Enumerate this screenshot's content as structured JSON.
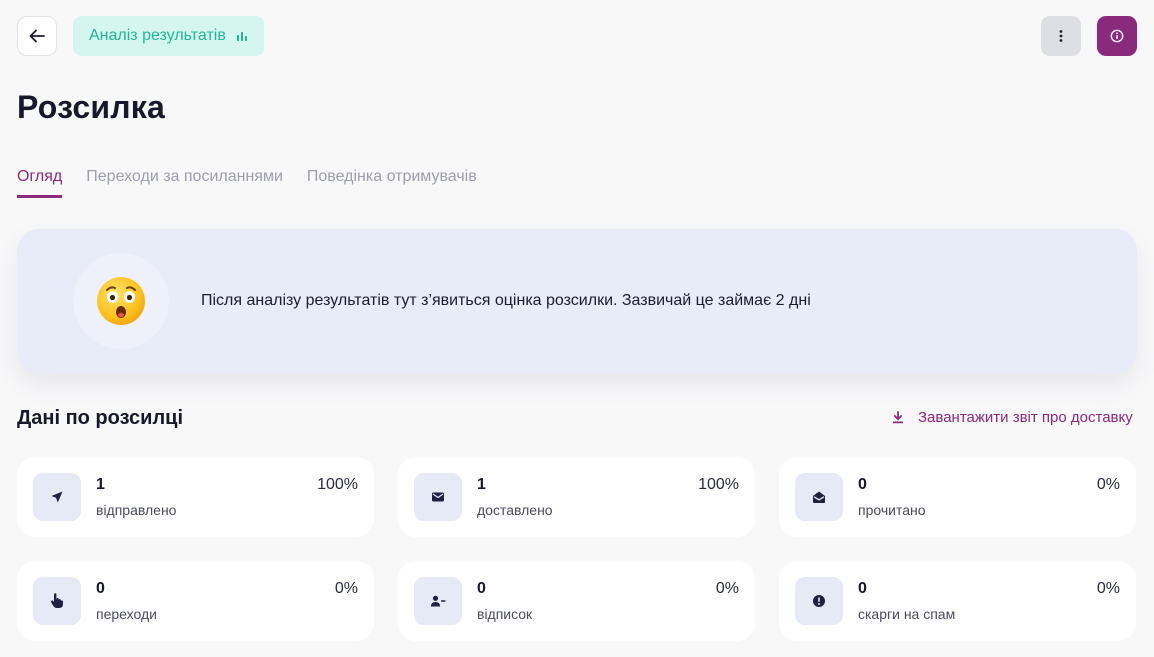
{
  "header": {
    "analysis_label": "Аналіз результатів"
  },
  "title": "Розсилка",
  "tabs": [
    {
      "label": "Огляд",
      "active": true
    },
    {
      "label": "Переходи за посиланнями",
      "active": false
    },
    {
      "label": "Поведінка отримувачів",
      "active": false
    }
  ],
  "banner": {
    "emoji": "astonished-face",
    "text": "Після аналізу результатів тут з’явиться оцінка розсилки. Зазвичай це займає 2 дні"
  },
  "section": {
    "title": "Дані по розсилці",
    "download_label": "Завантажити звіт про доставку"
  },
  "stats": [
    {
      "icon": "send-icon",
      "value": "1",
      "label": "відправлено",
      "percent": "100%"
    },
    {
      "icon": "envelope-icon",
      "value": "1",
      "label": "доставлено",
      "percent": "100%"
    },
    {
      "icon": "open-envelope-icon",
      "value": "0",
      "label": "прочитано",
      "percent": "0%"
    },
    {
      "icon": "pointer-hand-icon",
      "value": "0",
      "label": "переходи",
      "percent": "0%"
    },
    {
      "icon": "user-minus-icon",
      "value": "0",
      "label": "відписок",
      "percent": "0%"
    },
    {
      "icon": "alert-circle-icon",
      "value": "0",
      "label": "скарги на спам",
      "percent": "0%"
    }
  ],
  "colors": {
    "accent": "#8b2a7c",
    "analysis_bg": "#d4f6ef",
    "analysis_text": "#22b59a",
    "banner_bg": "#e8ebf8",
    "icon_bg": "#e6e9f6",
    "icon_color": "#1f2140"
  }
}
